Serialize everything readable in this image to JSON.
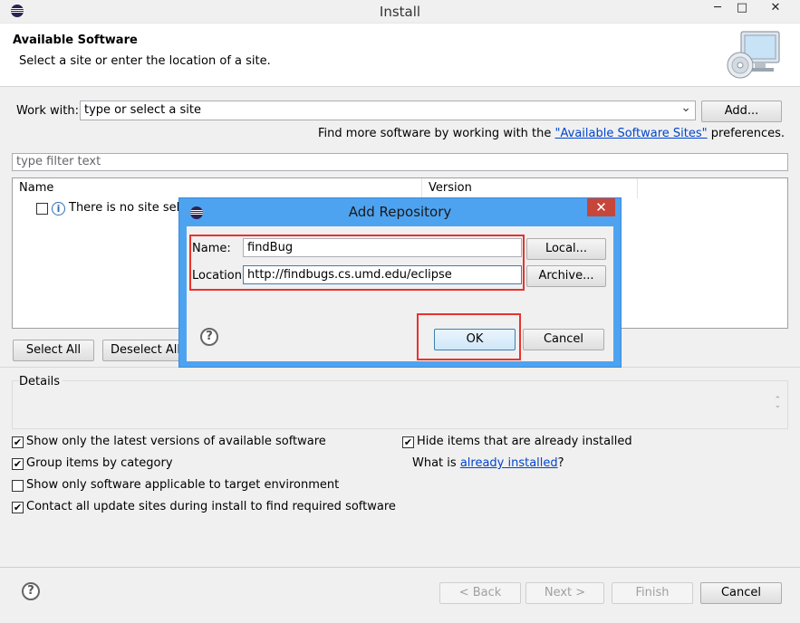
{
  "window": {
    "title": "Install",
    "minimize_glyph": "─",
    "maximize_glyph": "□",
    "close_glyph": "✕"
  },
  "header": {
    "title": "Available Software",
    "description": "Select a site or enter the location of a site."
  },
  "work_with": {
    "label": "Work with:",
    "value": "type or select a site",
    "dropdown_glyph": "⌄",
    "add_button": "Add..."
  },
  "find_more": {
    "prefix": "Find more software by working with the ",
    "link": "\"Available Software Sites\"",
    "suffix": " preferences."
  },
  "filter": {
    "placeholder": "type filter text"
  },
  "table": {
    "columns": [
      "Name",
      "Version"
    ],
    "rows": [
      {
        "name": "There is no site selec"
      }
    ]
  },
  "list_buttons": {
    "select_all": "Select All",
    "deselect_all": "Deselect All"
  },
  "details": {
    "label": "Details"
  },
  "options": [
    {
      "label": "Show only the latest versions of available software",
      "checked": true
    },
    {
      "label": "Group items by category",
      "checked": true
    },
    {
      "label": "Show only software applicable to target environment",
      "checked": false
    },
    {
      "label": "Contact all update sites during install to find required software",
      "checked": true
    },
    {
      "label": "Hide items that are already installed",
      "checked": true
    }
  ],
  "what_is": {
    "prefix": "What is ",
    "link": "already installed",
    "suffix": "?"
  },
  "footer": {
    "back": "< Back",
    "next": "Next >",
    "finish": "Finish",
    "cancel": "Cancel"
  },
  "dialog": {
    "title": "Add Repository",
    "close_glyph": "✕",
    "name_label": "Name:",
    "name_value": "findBug",
    "location_label": "Location:",
    "location_value": "http://findbugs.cs.umd.edu/eclipse",
    "local_button": "Local...",
    "archive_button": "Archive...",
    "ok_button": "OK",
    "cancel_button": "Cancel"
  },
  "icons": {
    "help": "?",
    "info": "i"
  },
  "colors": {
    "dialog_title_bar": "#4ea3f0",
    "close_button": "#c7463a",
    "highlight_box": "#e8332e",
    "link": "#0044cc"
  }
}
